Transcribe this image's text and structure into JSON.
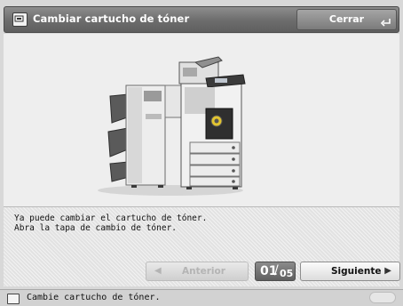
{
  "title_bar": {
    "title": "Cambiar cartucho de tóner",
    "icon": "toner-cartridge-icon",
    "close_label": "Cerrar"
  },
  "illustration": {
    "name": "printer-with-finisher-illustration"
  },
  "instructions": {
    "line1": "Ya puede cambiar el cartucho de tóner.",
    "line2": "Abra la tapa de cambio de tóner."
  },
  "navigation": {
    "previous_label": "Anterior",
    "previous_enabled": false,
    "next_label": "Siguiente",
    "page_current": "01",
    "page_separator": "/",
    "page_total": "05"
  },
  "status_bar": {
    "message": "Cambie cartucho de tóner.",
    "icon": "toner-status-icon"
  },
  "colors": {
    "title_bar": "#6f6f6f",
    "page_indicator": "#707070",
    "background": "#eeeeee"
  }
}
